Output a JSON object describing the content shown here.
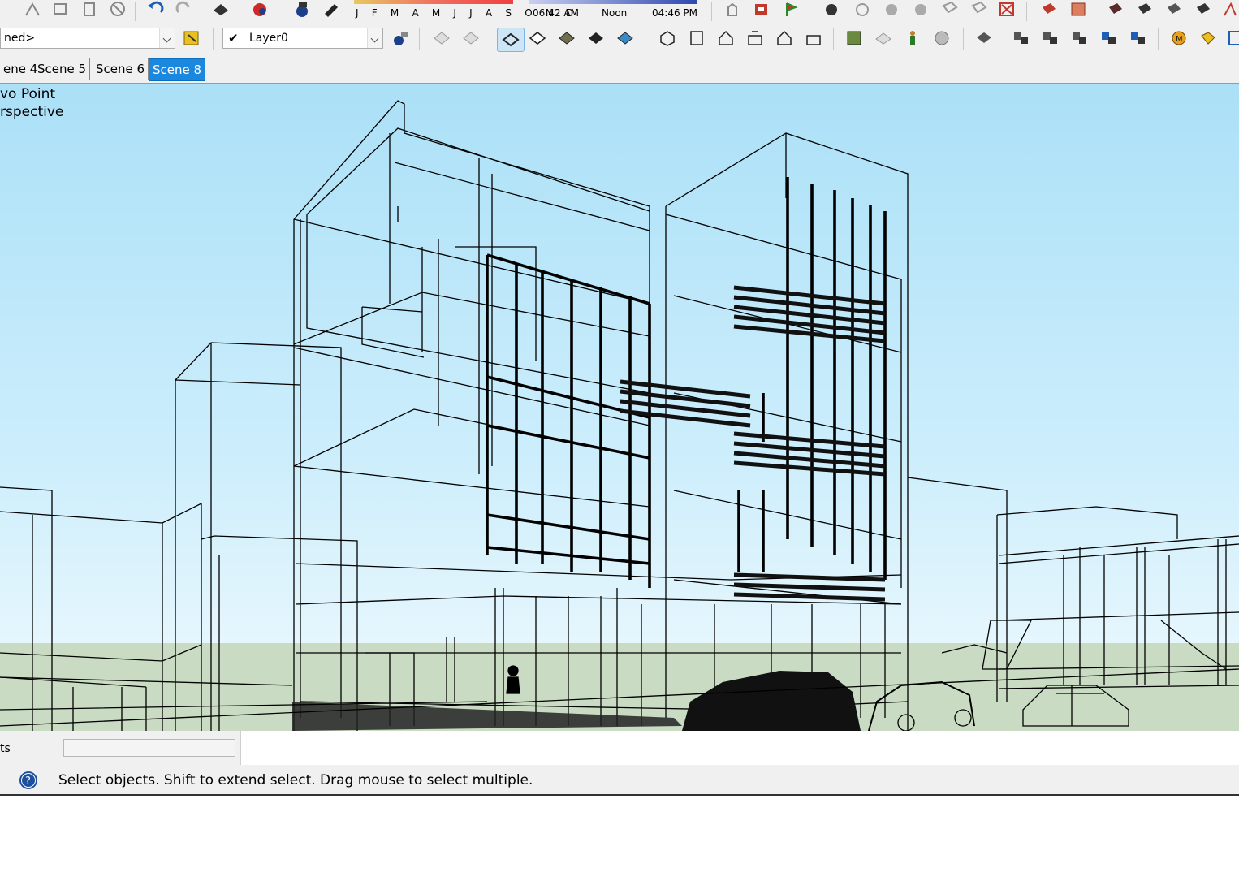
{
  "toolbar": {
    "months": "J F M A M J J A S O N D",
    "time_start": "06:42 AM",
    "time_mid": "Noon",
    "time_end": "04:46 PM",
    "style_combo": "ned>",
    "layer_combo": "Layer0"
  },
  "scenes": {
    "tab_1": "ene 4",
    "tab_2": "Scene 5",
    "tab_3": "Scene 6",
    "tab_active": "Scene 8"
  },
  "viewport": {
    "camera_line1": "vo Point",
    "camera_line2": "rspective"
  },
  "measurements": {
    "label": "ts",
    "value": ""
  },
  "status": {
    "text": "Select objects. Shift to extend select. Drag mouse to select multiple."
  },
  "colors": {
    "sky": "#abe0f7",
    "ground": "#cadbc4",
    "active_tab": "#1b88e0"
  }
}
